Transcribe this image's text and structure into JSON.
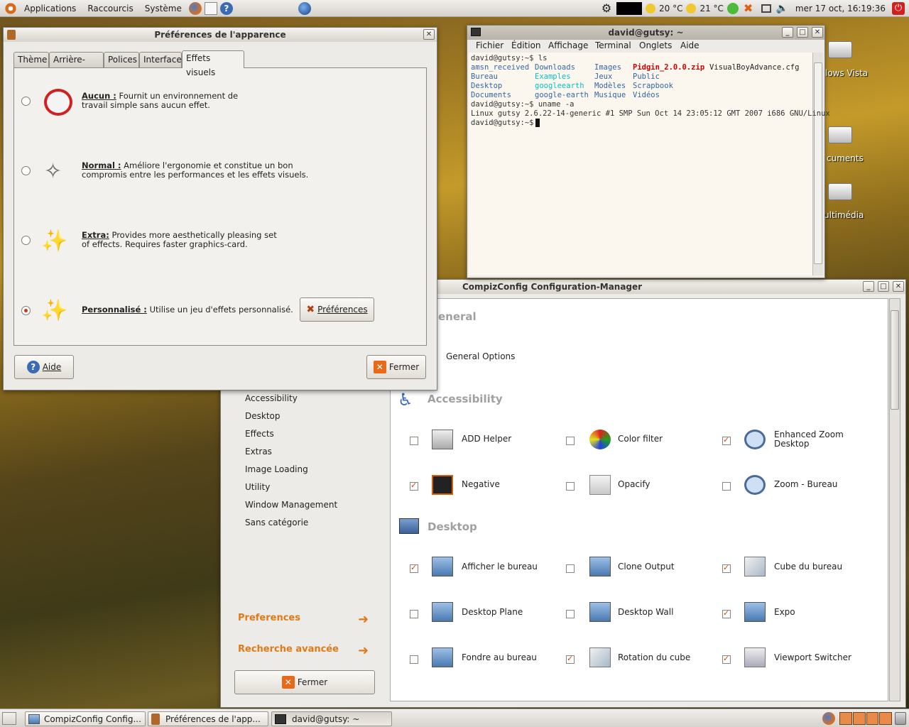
{
  "top_panel": {
    "applications": "Applications",
    "places": "Raccourcis",
    "system": "Système",
    "temp1": "20 °C",
    "temp2": "21 °C",
    "clock": "mer 17 oct, 16:19:36"
  },
  "desktop": {
    "icons": [
      "lows Vista",
      "cuments",
      "ultimédia"
    ]
  },
  "appearance": {
    "title": "Préférences de l'apparence",
    "tabs": [
      "Thème",
      "Arrière-plan",
      "Polices",
      "Interface",
      "Effets visuels"
    ],
    "options": [
      {
        "name": "Aucun :",
        "desc1": " Fournit un environnement de",
        "desc2": "travail simple sans aucun effet.",
        "selected": false
      },
      {
        "name": "Normal :",
        "desc1": " Améliore l'ergonomie et constitue un bon",
        "desc2": "compromis entre les performances et les effets visuels.",
        "selected": false
      },
      {
        "name": "Extra:",
        "desc1": " Provides more aesthetically pleasing set",
        "desc2": "of effects. Requires faster graphics-card.",
        "selected": false
      },
      {
        "name": "Personnalisé :",
        "desc1": " Utilise un jeu d'effets personnalisé.",
        "desc2": "",
        "selected": true
      }
    ],
    "prefs_button": "Préférences",
    "help_button": "Aide",
    "close_button": "Fermer"
  },
  "terminal": {
    "title": "david@gutsy: ~",
    "menu": [
      "Fichier",
      "Édition",
      "Affichage",
      "Terminal",
      "Onglets",
      "Aide"
    ],
    "line1": "david@gutsy:~$ ls",
    "ls": [
      [
        "amsn_received",
        "Downloads",
        "Images",
        "Pidgin_2.0.0.zip",
        "VisualBoyAdvance.cfg"
      ],
      [
        "Bureau",
        "Examples",
        "Jeux",
        "Public",
        ""
      ],
      [
        "Desktop",
        "googleearth",
        "Modèles",
        "Scrapbook",
        ""
      ],
      [
        "Documents",
        "google-earth",
        "Musique",
        "Vidéos",
        ""
      ]
    ],
    "line2": "david@gutsy:~$ uname -a",
    "line3": "Linux gutsy 2.6.22-14-generic #1 SMP Sun Oct 14 23:05:12 GMT 2007 i686 GNU/Linux",
    "line4": "david@gutsy:~$ "
  },
  "compiz": {
    "title": "CompizConfig Configuration-Manager",
    "general_header": "eneral",
    "general_options": "General Options",
    "categories": [
      "Accessibility",
      "Desktop",
      "Effects",
      "Extras",
      "Image Loading",
      "Utility",
      "Window Management",
      "Sans catégorie"
    ],
    "preferences_link": "Preferences",
    "advanced_search_link": "Recherche avancée",
    "close_button": "Fermer",
    "accessibility_header": "Accessibility",
    "accessibility": [
      {
        "label": "ADD Helper",
        "checked": false
      },
      {
        "label": "Color filter",
        "checked": false
      },
      {
        "label": "Enhanced Zoom\nDesktop",
        "checked": true
      },
      {
        "label": "Negative",
        "checked": true
      },
      {
        "label": "Opacify",
        "checked": false
      },
      {
        "label": "Zoom - Bureau",
        "checked": false
      }
    ],
    "desktop_header": "Desktop",
    "desktop": [
      {
        "label": "Afficher le bureau",
        "checked": true
      },
      {
        "label": "Clone Output",
        "checked": false
      },
      {
        "label": "Cube du bureau",
        "checked": true
      },
      {
        "label": "Desktop Plane",
        "checked": false
      },
      {
        "label": "Desktop Wall",
        "checked": false
      },
      {
        "label": "Expo",
        "checked": true
      },
      {
        "label": "Fondre au bureau",
        "checked": false
      },
      {
        "label": "Rotation du cube",
        "checked": true
      },
      {
        "label": "Viewport Switcher",
        "checked": true
      }
    ]
  },
  "taskbar": [
    "CompizConfig Config...",
    "Préférences de l'app...",
    "david@gutsy: ~"
  ],
  "colors": {
    "accent": "#e07a18",
    "ls_dir": "#3465a4",
    "ls_link": "#06c2c2",
    "ls_archive": "#cc0000"
  }
}
